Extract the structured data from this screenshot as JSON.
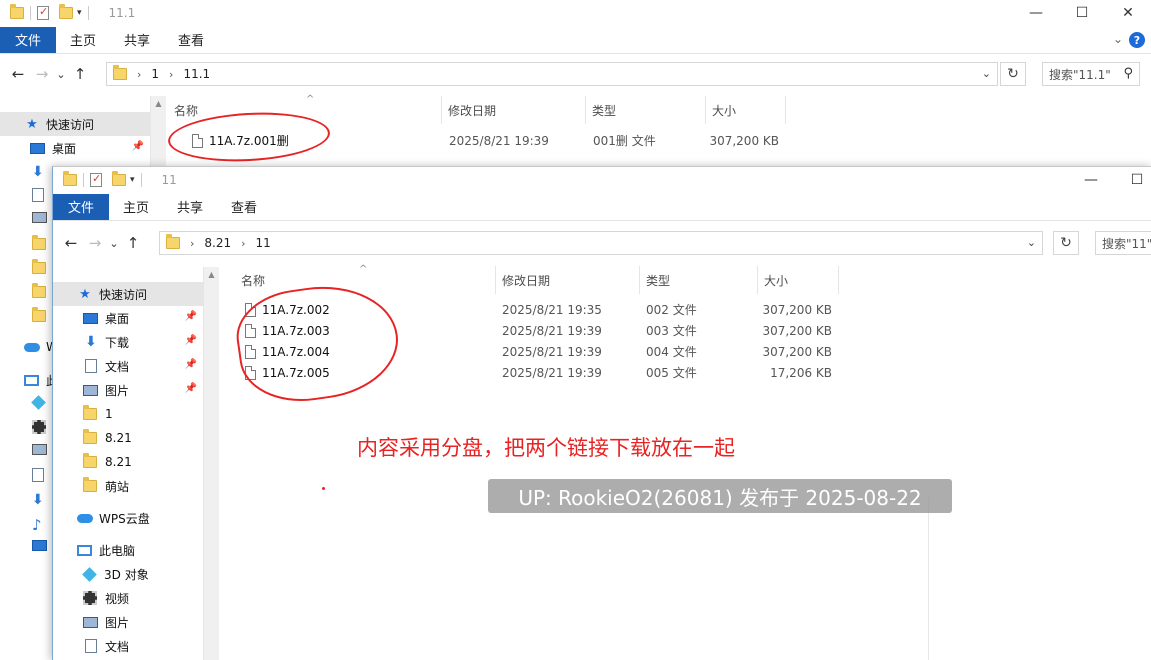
{
  "colors": {
    "accent": "#1a5fb4",
    "annotation": "#e82323",
    "watermark_bg": "#969696"
  },
  "window_back": {
    "title": "11.1",
    "window_controls": [
      "—",
      "☐",
      "✕"
    ],
    "ribbon": {
      "file": "文件",
      "tabs": [
        "主页",
        "共享",
        "查看"
      ]
    },
    "nav": {
      "back": "←",
      "forward": "→",
      "recent": "⌄",
      "up": "↑"
    },
    "address": {
      "crumbs": [
        "1",
        "11.1"
      ]
    },
    "search_placeholder": "搜索\"11.1\"",
    "sidebar": {
      "quick_access": "快速访问",
      "items": [
        "桌面"
      ]
    },
    "columns": {
      "name": "名称",
      "modified": "修改日期",
      "type": "类型",
      "size": "大小"
    },
    "files": [
      {
        "name": "11A.7z.001删",
        "modified": "2025/8/21 19:39",
        "type": "001删 文件",
        "size": "307,200 KB"
      }
    ]
  },
  "window_front": {
    "title": "11",
    "window_controls": [
      "—",
      "☐"
    ],
    "ribbon": {
      "file": "文件",
      "tabs": [
        "主页",
        "共享",
        "查看"
      ]
    },
    "nav": {
      "back": "←",
      "forward": "→",
      "recent": "⌄",
      "up": "↑"
    },
    "address": {
      "crumbs": [
        "8.21",
        "11"
      ]
    },
    "search_placeholder": "搜索\"11\"",
    "sidebar": {
      "quick_access": "快速访问",
      "pinned": [
        "桌面",
        "下载",
        "文档",
        "图片"
      ],
      "folders": [
        "1",
        "8.21",
        "8.21",
        "萌站"
      ],
      "wps": "WPS云盘",
      "this_pc": "此电脑",
      "pc_items": [
        "3D 对象",
        "视频",
        "图片",
        "文档"
      ]
    },
    "columns": {
      "name": "名称",
      "modified": "修改日期",
      "type": "类型",
      "size": "大小"
    },
    "files": [
      {
        "name": "11A.7z.002",
        "modified": "2025/8/21 19:35",
        "type": "002 文件",
        "size": "307,200 KB"
      },
      {
        "name": "11A.7z.003",
        "modified": "2025/8/21 19:39",
        "type": "003 文件",
        "size": "307,200 KB"
      },
      {
        "name": "11A.7z.004",
        "modified": "2025/8/21 19:39",
        "type": "004 文件",
        "size": "307,200 KB"
      },
      {
        "name": "11A.7z.005",
        "modified": "2025/8/21 19:39",
        "type": "005 文件",
        "size": "17,206 KB"
      }
    ]
  },
  "back_sidebar_partial": {
    "onedrive_initial": "W",
    "pc_initial": "此"
  },
  "annotation_text": "内容采用分盘，把两个链接下载放在一起",
  "watermark": "UP: RookieO2(26081) 发布于 2025-08-22"
}
